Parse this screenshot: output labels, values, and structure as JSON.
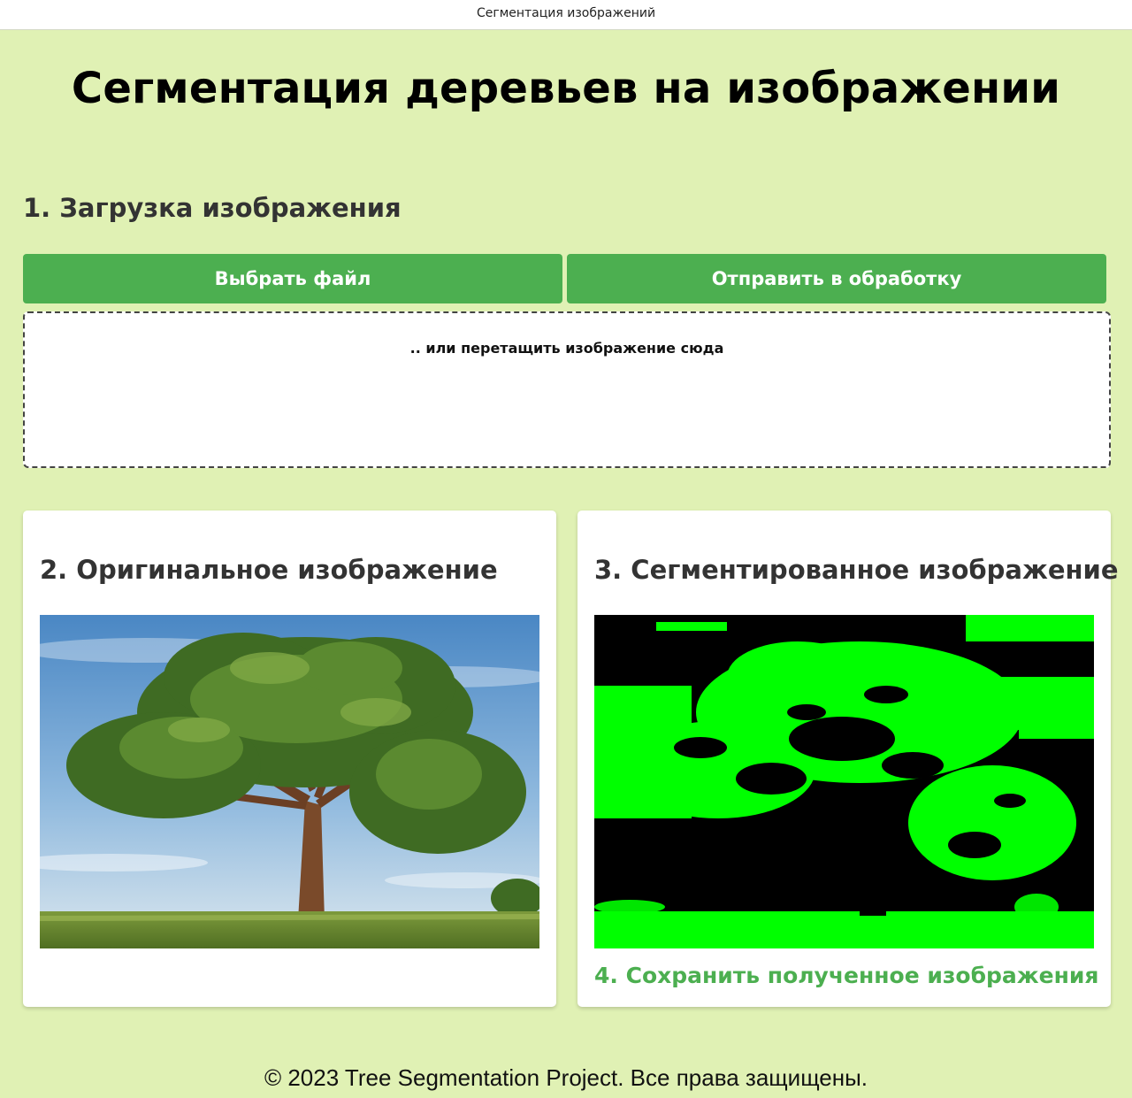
{
  "browser": {
    "tab_title": "Сегментация изображений"
  },
  "header": {
    "title": "Сегментация деревьев на изображении"
  },
  "upload": {
    "heading": "1. Загрузка изображения",
    "choose_file_label": "Выбрать файл",
    "submit_label": "Отправить в обработку",
    "drop_hint": ".. или перетащить изображение сюда"
  },
  "original": {
    "heading": "2. Оригинальное изображение"
  },
  "segmented": {
    "heading": "3. Сегментированное изображение",
    "save_link": "4. Сохранить полученное изображения"
  },
  "footer": {
    "copyright": "© 2023 Tree Segmentation Project. Все права защищены."
  },
  "colors": {
    "page_bg": "#e0f1b4",
    "accent": "#4caf50",
    "mask_fg": "#00ff00",
    "mask_bg": "#000000"
  }
}
